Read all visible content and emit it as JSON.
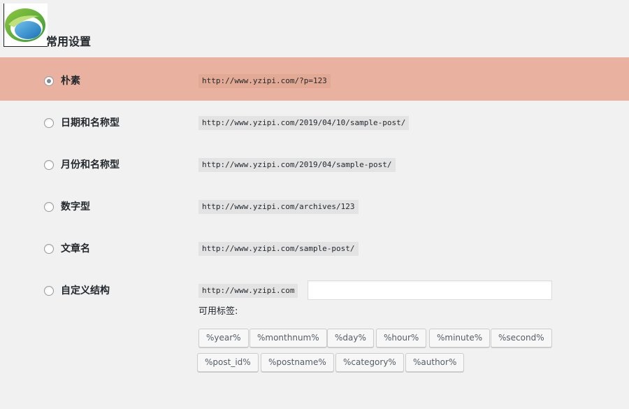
{
  "section_title": "常用设置",
  "options": [
    {
      "label": "朴素",
      "example": "http://www.yzipi.com/?p=123",
      "selected": true
    },
    {
      "label": "日期和名称型",
      "example": "http://www.yzipi.com/2019/04/10/sample-post/",
      "selected": false
    },
    {
      "label": "月份和名称型",
      "example": "http://www.yzipi.com/2019/04/sample-post/",
      "selected": false
    },
    {
      "label": "数字型",
      "example": "http://www.yzipi.com/archives/123",
      "selected": false
    },
    {
      "label": "文章名",
      "example": "http://www.yzipi.com/sample-post/",
      "selected": false
    },
    {
      "label": "自定义结构",
      "example": "http://www.yzipi.com",
      "selected": false
    }
  ],
  "custom_structure_value": "",
  "available_tags_label": "可用标签:",
  "tags": [
    "%year%",
    "%monthnum%",
    "%day%",
    "%hour%",
    "%minute%",
    "%second%",
    "%post_id%",
    "%postname%",
    "%category%",
    "%author%"
  ],
  "colors": {
    "selected_row": "#e8b1a0",
    "background": "#f1f1f1",
    "code_background": "#e3e3e3"
  }
}
